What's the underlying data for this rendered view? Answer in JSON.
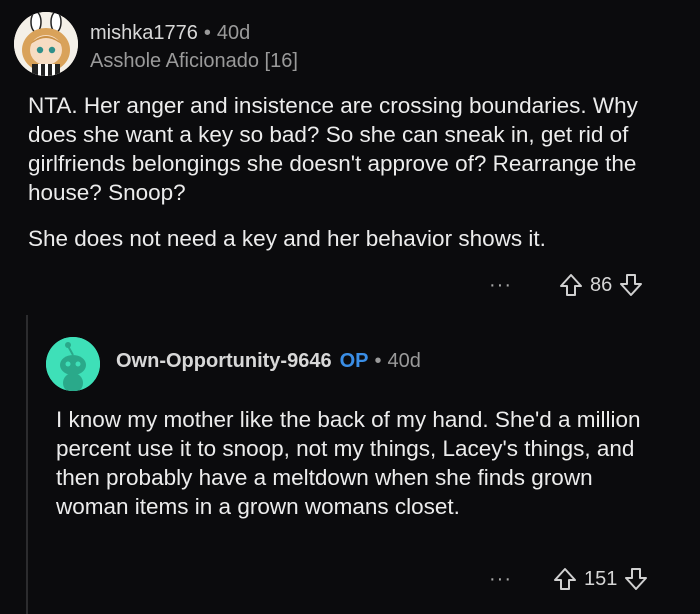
{
  "comments": [
    {
      "username": "mishka1776",
      "age": "40d",
      "flair": "Asshole Aficionado [16]",
      "paragraphs": [
        "NTA. Her anger and insistence are crossing boundaries. Why does she want a key so bad? So she can sneak in, get rid of girlfriends belongings she doesn't approve of? Rearrange the house? Snoop?",
        "She does not need a key and her behavior shows it."
      ],
      "score": "86",
      "more_label": "···"
    },
    {
      "username": "Own-Opportunity-9646",
      "op_badge": "OP",
      "age": "40d",
      "paragraphs": [
        "I know my mother like the back of my hand. She'd a million percent use it to snoop, not my things, Lacey's things, and then probably have a meltdown when she finds grown woman items in a grown womans closet."
      ],
      "score": "151",
      "more_label": "···"
    }
  ],
  "colors": {
    "background": "#0b0b0d",
    "op_badge": "#3a8ee6",
    "default_avatar": "#3ee0b8"
  },
  "icons": [
    "upvote-icon",
    "downvote-icon",
    "more-options-icon",
    "snoo-avatar-icon"
  ]
}
